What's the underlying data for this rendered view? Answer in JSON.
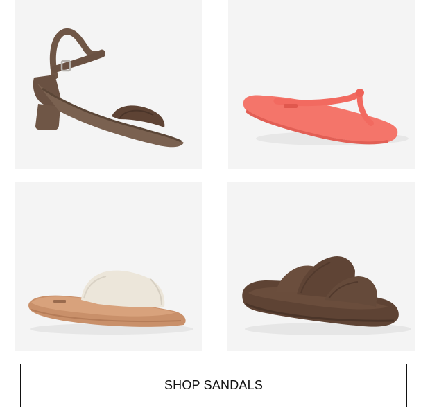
{
  "products": [
    {
      "kind": "heeled-sandal",
      "color": "#6f5646"
    },
    {
      "kind": "flip-flop",
      "color": "#f4756a"
    },
    {
      "kind": "slide-sandal",
      "color": "#ece6da",
      "sole_color": "#c9906a"
    },
    {
      "kind": "strappy-slide",
      "color": "#5e4334"
    }
  ],
  "cta": {
    "label": "SHOP SANDALS"
  }
}
